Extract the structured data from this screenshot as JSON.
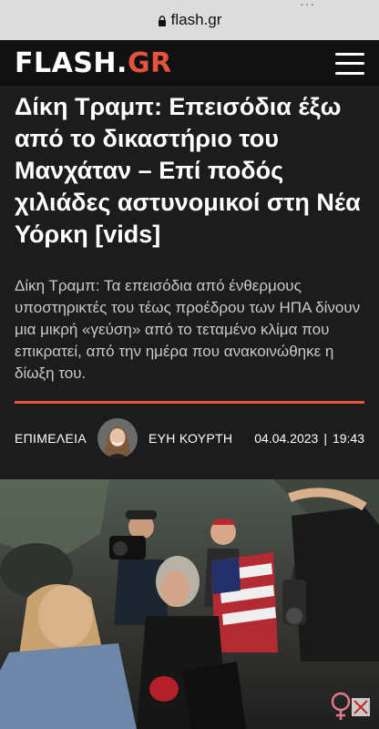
{
  "browser": {
    "url": "flash.gr",
    "menu_dots": "···"
  },
  "header": {
    "logo_brand": "FLASH.",
    "logo_tld": "GR",
    "menu_icon": "hamburger-menu-icon"
  },
  "article": {
    "headline": "Δίκη Τραμπ: Επεισόδια έξω από το δικαστήριο του Μανχάταν – Επί ποδός χιλιάδες αστυνομικοί στη Νέα Υόρκη [vids]",
    "lead": "Δίκη Τραμπ: Τα επεισόδια από ένθερμους υποστηρικτές του τέως προέδρου των ΗΠΑ δίνουν μια μικρή «γεύση» από το τεταμένο κλίμα που επικρατεί, από την ημέρα που ανακοινώθηκε η δίωξη του.",
    "curator_label": "ΕΠΙΜΕΛΕΙΑ",
    "author": "ΕΥΗ ΚΟΥΡΤΗ",
    "date": "04.04.2023",
    "separator": "|",
    "time": "19:43",
    "image_alt": "Επεισόδια έξω από το δικαστήριο του Μανχάταν"
  },
  "colors": {
    "accent": "#e5533d",
    "background": "#1c1c1c",
    "header_bg": "#111111",
    "url_bar_bg": "#dcdcdc"
  }
}
